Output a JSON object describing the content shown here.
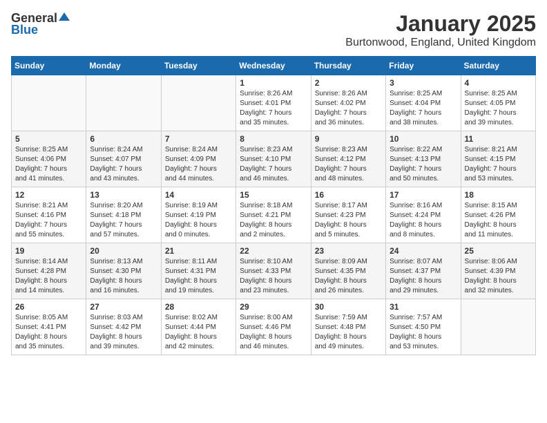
{
  "logo": {
    "general": "General",
    "blue": "Blue"
  },
  "title": "January 2025",
  "location": "Burtonwood, England, United Kingdom",
  "days_header": [
    "Sunday",
    "Monday",
    "Tuesday",
    "Wednesday",
    "Thursday",
    "Friday",
    "Saturday"
  ],
  "weeks": [
    [
      {
        "day": "",
        "info": ""
      },
      {
        "day": "",
        "info": ""
      },
      {
        "day": "",
        "info": ""
      },
      {
        "day": "1",
        "info": "Sunrise: 8:26 AM\nSunset: 4:01 PM\nDaylight: 7 hours\nand 35 minutes."
      },
      {
        "day": "2",
        "info": "Sunrise: 8:26 AM\nSunset: 4:02 PM\nDaylight: 7 hours\nand 36 minutes."
      },
      {
        "day": "3",
        "info": "Sunrise: 8:25 AM\nSunset: 4:04 PM\nDaylight: 7 hours\nand 38 minutes."
      },
      {
        "day": "4",
        "info": "Sunrise: 8:25 AM\nSunset: 4:05 PM\nDaylight: 7 hours\nand 39 minutes."
      }
    ],
    [
      {
        "day": "5",
        "info": "Sunrise: 8:25 AM\nSunset: 4:06 PM\nDaylight: 7 hours\nand 41 minutes."
      },
      {
        "day": "6",
        "info": "Sunrise: 8:24 AM\nSunset: 4:07 PM\nDaylight: 7 hours\nand 43 minutes."
      },
      {
        "day": "7",
        "info": "Sunrise: 8:24 AM\nSunset: 4:09 PM\nDaylight: 7 hours\nand 44 minutes."
      },
      {
        "day": "8",
        "info": "Sunrise: 8:23 AM\nSunset: 4:10 PM\nDaylight: 7 hours\nand 46 minutes."
      },
      {
        "day": "9",
        "info": "Sunrise: 8:23 AM\nSunset: 4:12 PM\nDaylight: 7 hours\nand 48 minutes."
      },
      {
        "day": "10",
        "info": "Sunrise: 8:22 AM\nSunset: 4:13 PM\nDaylight: 7 hours\nand 50 minutes."
      },
      {
        "day": "11",
        "info": "Sunrise: 8:21 AM\nSunset: 4:15 PM\nDaylight: 7 hours\nand 53 minutes."
      }
    ],
    [
      {
        "day": "12",
        "info": "Sunrise: 8:21 AM\nSunset: 4:16 PM\nDaylight: 7 hours\nand 55 minutes."
      },
      {
        "day": "13",
        "info": "Sunrise: 8:20 AM\nSunset: 4:18 PM\nDaylight: 7 hours\nand 57 minutes."
      },
      {
        "day": "14",
        "info": "Sunrise: 8:19 AM\nSunset: 4:19 PM\nDaylight: 8 hours\nand 0 minutes."
      },
      {
        "day": "15",
        "info": "Sunrise: 8:18 AM\nSunset: 4:21 PM\nDaylight: 8 hours\nand 2 minutes."
      },
      {
        "day": "16",
        "info": "Sunrise: 8:17 AM\nSunset: 4:23 PM\nDaylight: 8 hours\nand 5 minutes."
      },
      {
        "day": "17",
        "info": "Sunrise: 8:16 AM\nSunset: 4:24 PM\nDaylight: 8 hours\nand 8 minutes."
      },
      {
        "day": "18",
        "info": "Sunrise: 8:15 AM\nSunset: 4:26 PM\nDaylight: 8 hours\nand 11 minutes."
      }
    ],
    [
      {
        "day": "19",
        "info": "Sunrise: 8:14 AM\nSunset: 4:28 PM\nDaylight: 8 hours\nand 14 minutes."
      },
      {
        "day": "20",
        "info": "Sunrise: 8:13 AM\nSunset: 4:30 PM\nDaylight: 8 hours\nand 16 minutes."
      },
      {
        "day": "21",
        "info": "Sunrise: 8:11 AM\nSunset: 4:31 PM\nDaylight: 8 hours\nand 19 minutes."
      },
      {
        "day": "22",
        "info": "Sunrise: 8:10 AM\nSunset: 4:33 PM\nDaylight: 8 hours\nand 23 minutes."
      },
      {
        "day": "23",
        "info": "Sunrise: 8:09 AM\nSunset: 4:35 PM\nDaylight: 8 hours\nand 26 minutes."
      },
      {
        "day": "24",
        "info": "Sunrise: 8:07 AM\nSunset: 4:37 PM\nDaylight: 8 hours\nand 29 minutes."
      },
      {
        "day": "25",
        "info": "Sunrise: 8:06 AM\nSunset: 4:39 PM\nDaylight: 8 hours\nand 32 minutes."
      }
    ],
    [
      {
        "day": "26",
        "info": "Sunrise: 8:05 AM\nSunset: 4:41 PM\nDaylight: 8 hours\nand 35 minutes."
      },
      {
        "day": "27",
        "info": "Sunrise: 8:03 AM\nSunset: 4:42 PM\nDaylight: 8 hours\nand 39 minutes."
      },
      {
        "day": "28",
        "info": "Sunrise: 8:02 AM\nSunset: 4:44 PM\nDaylight: 8 hours\nand 42 minutes."
      },
      {
        "day": "29",
        "info": "Sunrise: 8:00 AM\nSunset: 4:46 PM\nDaylight: 8 hours\nand 46 minutes."
      },
      {
        "day": "30",
        "info": "Sunrise: 7:59 AM\nSunset: 4:48 PM\nDaylight: 8 hours\nand 49 minutes."
      },
      {
        "day": "31",
        "info": "Sunrise: 7:57 AM\nSunset: 4:50 PM\nDaylight: 8 hours\nand 53 minutes."
      },
      {
        "day": "",
        "info": ""
      }
    ]
  ]
}
